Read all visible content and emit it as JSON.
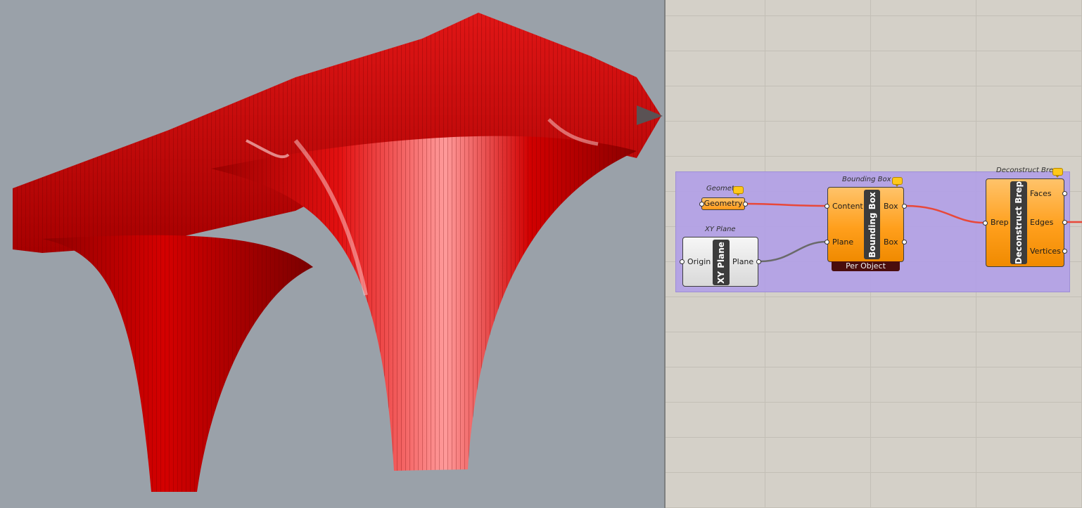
{
  "viewport": {
    "background": "#9aa1a9",
    "geometry_color": "#c40000"
  },
  "canvas": {
    "background": "#d4d0c8",
    "group_color": "#b4a2ea"
  },
  "components": {
    "geometry": {
      "title": "Geomet",
      "label": "Geometry"
    },
    "xy_plane": {
      "title": "XY Plane",
      "nickname": "XY Plane",
      "input": "Origin",
      "output": "Plane"
    },
    "bounding_box": {
      "title": "Bounding Box",
      "nickname": "Bounding Box",
      "inputs": [
        "Content",
        "Plane"
      ],
      "outputs": [
        "Box",
        "Box"
      ],
      "mode": "Per Object"
    },
    "deconstruct_brep": {
      "title": "Deconstruct Brep",
      "nickname": "Deconstruct Brep",
      "input": "Brep",
      "outputs": [
        "Faces",
        "Edges",
        "Vertices"
      ]
    }
  },
  "wires": {
    "active_color": "#e8483a",
    "plane_color": "#6a6a6a"
  }
}
